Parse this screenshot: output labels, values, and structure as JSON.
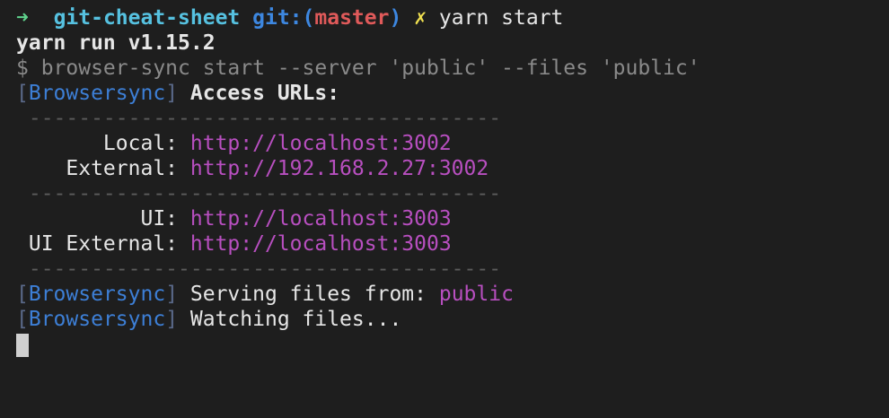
{
  "prompt": {
    "arrow": "➜",
    "directory": "git-cheat-sheet",
    "git_prefix": "git:(",
    "branch": "master",
    "git_suffix": ")",
    "dirty_mark": "✗",
    "command": "yarn start"
  },
  "lines": {
    "yarn_version": "yarn run v1.15.2",
    "executed": "$ browser-sync start --server 'public' --files 'public'",
    "bs_open": "[",
    "bs_name": "Browsersync",
    "bs_close": "]",
    "access_urls": " Access URLs:",
    "separator": " --------------------------------------",
    "local_label": "       Local: ",
    "local_url": "http://localhost:3002",
    "external_label": "    External: ",
    "external_url": "http://192.168.2.27:3002",
    "ui_label": "          UI: ",
    "ui_url": "http://localhost:3003",
    "ui_external_label": " UI External: ",
    "ui_external_url": "http://localhost:3003",
    "serving_text": " Serving files from: ",
    "serving_dir": "public",
    "watching_text": " Watching files..."
  },
  "colors": {
    "background": "#1e1e1e",
    "url": "#b84fc0",
    "browsersync": "#3d7fd6",
    "branch": "#e05a5a",
    "directory": "#56c1e0"
  }
}
